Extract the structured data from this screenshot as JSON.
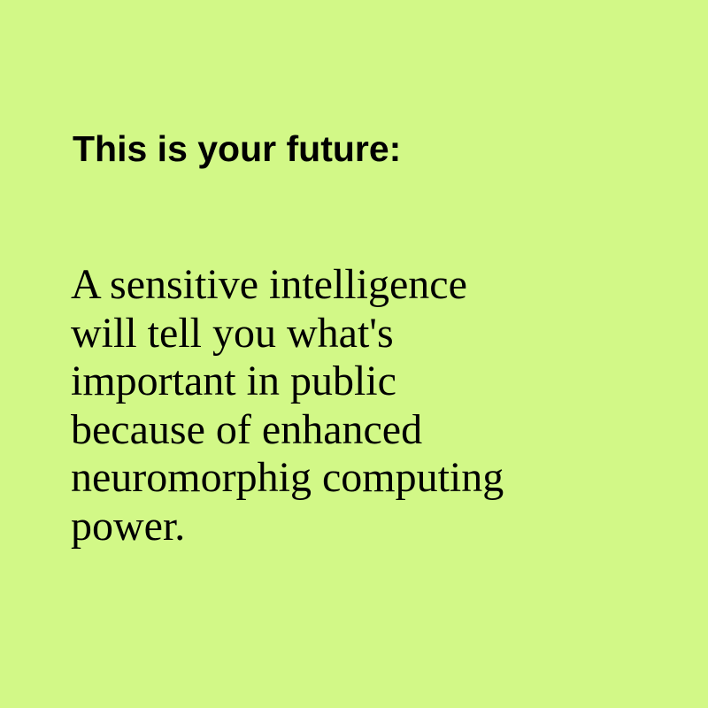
{
  "background_color": "#d2f887",
  "text_color": "#000000",
  "headline": "This is your future:",
  "body_lines": [
    "A sensitive intelligence",
    "will tell you what's",
    "important in public",
    "because of enhanced",
    "neuromorphig computing",
    "power."
  ]
}
